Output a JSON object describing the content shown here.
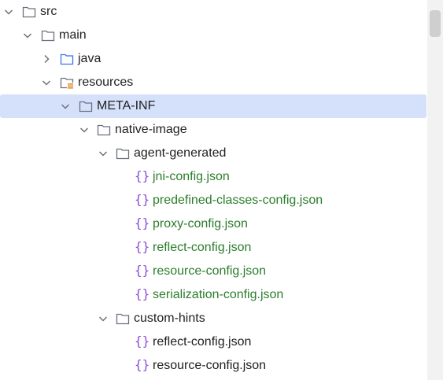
{
  "tree": {
    "nodes": [
      {
        "label": "src",
        "expanded": true,
        "icon": "folder-icon"
      },
      {
        "label": "main",
        "expanded": true,
        "icon": "folder-icon"
      },
      {
        "label": "java",
        "expanded": false,
        "icon": "source-folder-icon"
      },
      {
        "label": "resources",
        "expanded": true,
        "icon": "resources-folder-icon"
      },
      {
        "label": "META-INF",
        "expanded": true,
        "icon": "folder-icon",
        "selected": true
      },
      {
        "label": "native-image",
        "expanded": true,
        "icon": "folder-icon"
      },
      {
        "label": "agent-generated",
        "expanded": true,
        "icon": "folder-icon"
      },
      {
        "label": "jni-config.json",
        "icon": "json-file-icon"
      },
      {
        "label": "predefined-classes-config.json",
        "icon": "json-file-icon"
      },
      {
        "label": "proxy-config.json",
        "icon": "json-file-icon"
      },
      {
        "label": "reflect-config.json",
        "icon": "json-file-icon"
      },
      {
        "label": "resource-config.json",
        "icon": "json-file-icon"
      },
      {
        "label": "serialization-config.json",
        "icon": "json-file-icon"
      },
      {
        "label": "custom-hints",
        "expanded": true,
        "icon": "folder-icon"
      },
      {
        "label": "reflect-config.json",
        "icon": "json-file-icon"
      },
      {
        "label": "resource-config.json",
        "icon": "json-file-icon"
      }
    ]
  },
  "colors": {
    "selection": "#d5e1fb",
    "json_new_file": "#2b7d2b",
    "json_icon": "#8a4fd8",
    "source_folder": "#3574f0"
  }
}
